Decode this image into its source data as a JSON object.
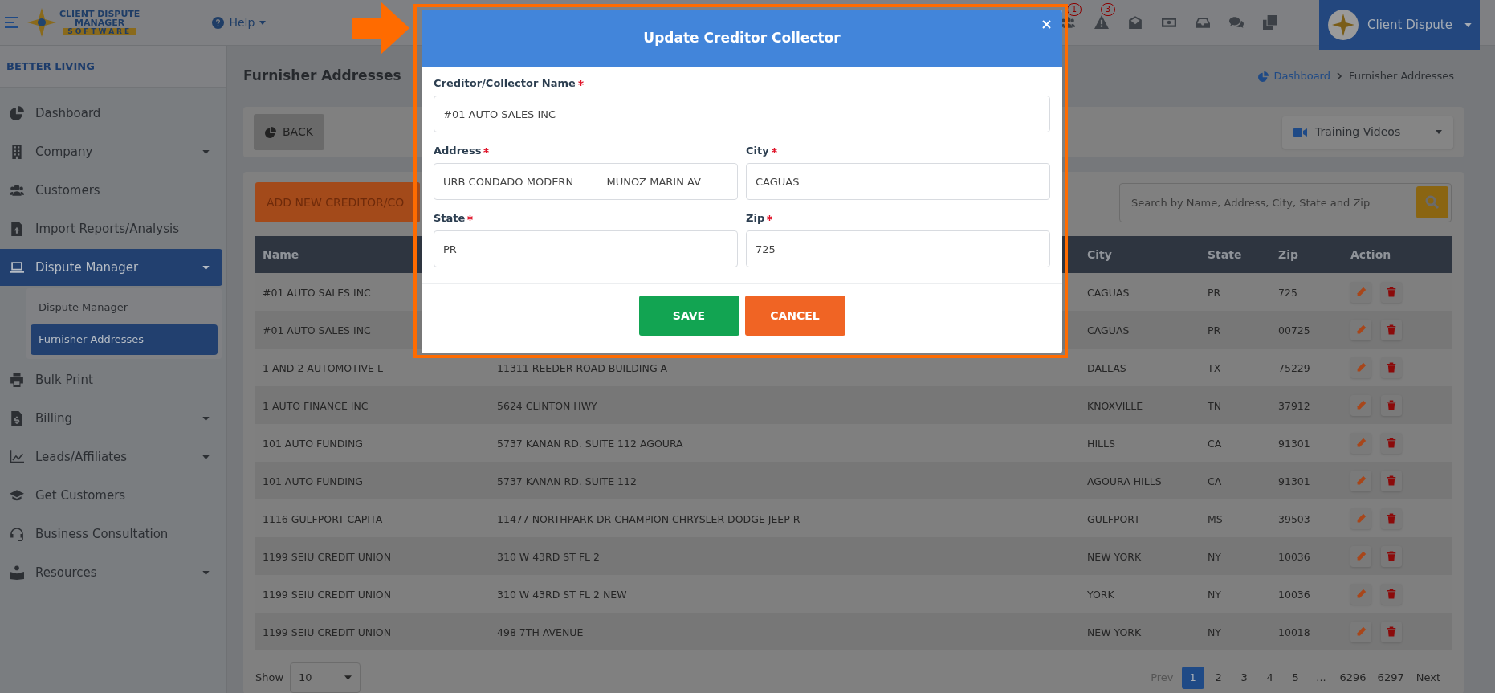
{
  "topbar": {
    "logo": {
      "line_1": "CLIENT DISPUTE",
      "line_2": "MANAGER",
      "line_3": "SOFTWARE"
    },
    "help": "Help",
    "notifications": [
      {
        "kind": "users",
        "badge": "1"
      },
      {
        "kind": "warning",
        "badge": "3"
      },
      {
        "kind": "envelope"
      },
      {
        "kind": "money"
      },
      {
        "kind": "inbox"
      },
      {
        "kind": "comments"
      },
      {
        "kind": "copy"
      }
    ],
    "profile": "Client Dispute"
  },
  "sidebar": {
    "company": "BETTER LIVING",
    "items": [
      {
        "kind": "pie",
        "label": "Dashboard",
        "selected": false
      },
      {
        "kind": "building",
        "label": "Company",
        "selected": false,
        "has_submenu": true
      },
      {
        "kind": "users",
        "label": "Customers",
        "selected": false
      },
      {
        "kind": "file",
        "label": "Import Reports/Analysis",
        "selected": false
      },
      {
        "kind": "laptop",
        "label": "Dispute Manager",
        "selected": true,
        "has_submenu": true,
        "children": [
          {
            "label": "Dispute Manager",
            "selected": false
          },
          {
            "label": "Furnisher Addresses",
            "selected": true
          }
        ]
      },
      {
        "kind": "printer",
        "label": "Bulk Print",
        "selected": false
      },
      {
        "kind": "invoice",
        "label": "Billing",
        "selected": false,
        "has_submenu": true
      },
      {
        "kind": "chart",
        "label": "Leads/Affiliates",
        "selected": false,
        "has_submenu": true
      },
      {
        "kind": "cap",
        "label": "Get Customers",
        "selected": false
      },
      {
        "kind": "headset",
        "label": "Business Consultation",
        "selected": false
      },
      {
        "kind": "book",
        "label": "Resources",
        "selected": false,
        "has_submenu": true
      }
    ]
  },
  "page": {
    "title": "Furnisher Addresses",
    "breadcrumb": [
      "Dashboard",
      "Furnisher Addresses"
    ],
    "back_button": "BACK",
    "training_videos": "Training Videos",
    "add_button": "ADD NEW CREDITOR/CO",
    "search": {
      "placeholder": "Search by Name, Address, City, State and Zip"
    }
  },
  "table": {
    "columns": {
      "name": "Name",
      "city": "City",
      "state": "State",
      "zip": "Zip",
      "action": "Action"
    },
    "rows": [
      {
        "name": "#01 AUTO SALES INC",
        "city": "CAGUAS",
        "state": "PR",
        "zip": "725"
      },
      {
        "name": "#01 AUTO SALES INC",
        "city": "CAGUAS",
        "state": "PR",
        "zip": "00725"
      },
      {
        "name": "1 AND 2 AUTOMOTIVE L",
        "address": "11311 REEDER ROAD BUILDING A",
        "city": "DALLAS",
        "state": "TX",
        "zip": "75229"
      },
      {
        "name": "1 AUTO FINANCE INC",
        "address": "5624 CLINTON HWY",
        "city": "KNOXVILLE",
        "state": "TN",
        "zip": "37912"
      },
      {
        "name": "101 AUTO FUNDING",
        "address": "5737 KANAN RD. SUITE 112 AGOURA",
        "city": "HILLS",
        "state": "CA",
        "zip": "91301"
      },
      {
        "name": "101 AUTO FUNDING",
        "address": "5737 KANAN RD. SUITE 112",
        "city": "AGOURA HILLS",
        "state": "CA",
        "zip": "91301"
      },
      {
        "name": "1116 GULFPORT CAPITA",
        "address": "11477 NORTHPARK DR CHAMPION CHRYSLER DODGE JEEP R",
        "city": "GULFPORT",
        "state": "MS",
        "zip": "39503"
      },
      {
        "name": "1199 SEIU CREDIT UNION",
        "address": "310 W 43RD ST FL 2",
        "city": "NEW YORK",
        "state": "NY",
        "zip": "10036"
      },
      {
        "name": "1199 SEIU CREDIT UNION",
        "address": "310 W 43RD ST FL 2 NEW",
        "city": "YORK",
        "state": "NY",
        "zip": "10036"
      },
      {
        "name": "1199 SEIU CREDIT UNION",
        "address": "498 7TH AVENUE",
        "city": "NEW YORK",
        "state": "NY",
        "zip": "10018"
      }
    ]
  },
  "pagination": {
    "show_label": "Show",
    "page_size": "10",
    "prev": "Prev",
    "pages": [
      {
        "label": "1",
        "selected": true
      },
      {
        "label": "2",
        "selected": false
      },
      {
        "label": "3",
        "selected": false
      },
      {
        "label": "4",
        "selected": false
      },
      {
        "label": "5",
        "selected": false
      },
      {
        "label": "...",
        "selected": false
      },
      {
        "label": "6296",
        "selected": false
      },
      {
        "label": "6297",
        "selected": false
      }
    ],
    "next": "Next"
  },
  "modal": {
    "title": "Update Creditor Collector",
    "fields": [
      {
        "label": "Creditor/Collector Name",
        "required": true,
        "value": "#01 AUTO SALES INC"
      },
      {
        "label": "Address",
        "required": true,
        "value": "URB CONDADO MODERN          MUNOZ MARIN AV"
      },
      {
        "label": "City",
        "required": true,
        "value": "CAGUAS"
      },
      {
        "label": "State",
        "required": true,
        "value": "PR"
      },
      {
        "label": "Zip",
        "required": true,
        "value": "725"
      }
    ],
    "buttons": [
      {
        "kind": "save",
        "label": "SAVE"
      },
      {
        "kind": "cancel",
        "label": "CANCEL"
      }
    ]
  }
}
